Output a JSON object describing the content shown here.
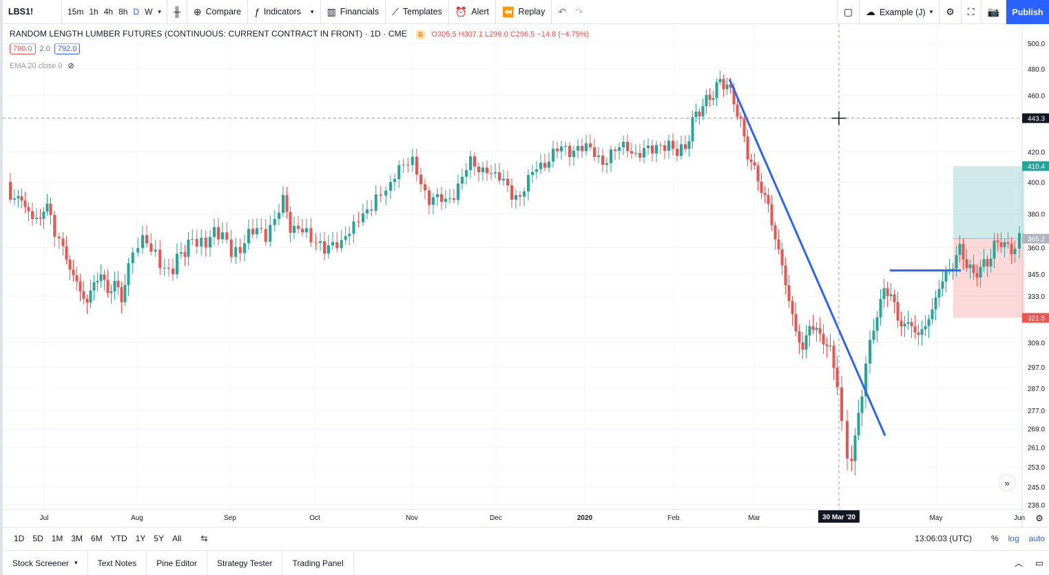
{
  "toolbar": {
    "symbol": "LBS1!",
    "intervals": [
      "15m",
      "1h",
      "4h",
      "8h",
      "D",
      "W"
    ],
    "active_interval": "D",
    "compare": "Compare",
    "indicators": "Indicators",
    "financials": "Financials",
    "templates": "Templates",
    "alert": "Alert",
    "replay": "Replay",
    "layout_name": "Example (J)",
    "publish": "Publish"
  },
  "legend": {
    "title": "RANDOM LENGTH LUMBER FUTURES (CONTINUOUS: CURRENT CONTRACT IN FRONT) · 1D · CME",
    "badge": "D",
    "ohlc": "O305.5 H307.1 L296.0 C296.5 −14.8 (−4.75%)",
    "bid": "790.0",
    "spread": "2.0",
    "ask": "792.0",
    "ema": "EMA 20 close 0"
  },
  "chart_data": {
    "type": "candlestick",
    "y_axis_labels": [
      "500.0",
      "480.0",
      "460.0",
      "420.0",
      "400.0",
      "380.0",
      "360.0",
      "345.0",
      "333.0",
      "309.0",
      "297.0",
      "287.0",
      "277.0",
      "269.0",
      "261.0",
      "253.0",
      "245.0",
      "238.0"
    ],
    "x_axis_labels": [
      "Jul",
      "Aug",
      "Sep",
      "Oct",
      "Nov",
      "Dec",
      "2020",
      "Feb",
      "Mar",
      "May",
      "Jun"
    ],
    "crosshair_date": "30 Mar '20",
    "crosshair_price": "443.3",
    "price_badges": [
      {
        "label": "410.4",
        "color": "#26a69a"
      },
      {
        "label": "365.2",
        "color": "#b2b5be"
      },
      {
        "label": "321.5",
        "color": "#ef5350"
      }
    ],
    "log_scale": true
  },
  "bottom": {
    "ranges": [
      "1D",
      "5D",
      "1M",
      "3M",
      "6M",
      "YTD",
      "1Y",
      "5Y",
      "All"
    ],
    "time": "13:06:03 (UTC)",
    "percent": "%",
    "log": "log",
    "auto": "auto"
  },
  "panels": [
    "Stock Screener",
    "Text Notes",
    "Pine Editor",
    "Strategy Tester",
    "Trading Panel"
  ]
}
